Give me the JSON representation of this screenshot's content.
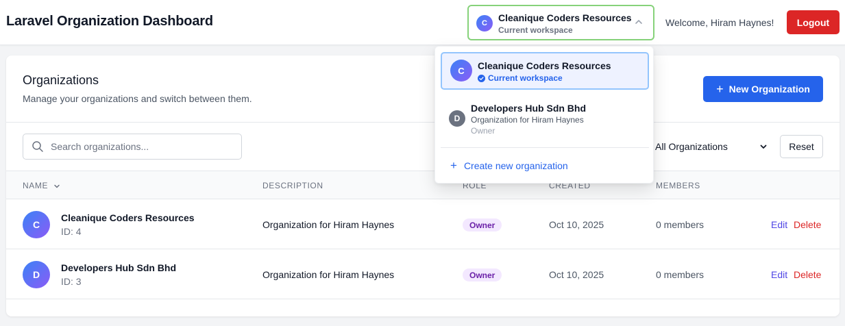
{
  "header": {
    "title": "Laravel Organization Dashboard",
    "workspace": {
      "avatar_letter": "C",
      "name": "Cleanique Coders Resources",
      "subtitle": "Current workspace"
    },
    "welcome": "Welcome, Hiram Haynes!",
    "logout_label": "Logout"
  },
  "dropdown": {
    "current": {
      "avatar_letter": "C",
      "name": "Cleanique Coders Resources",
      "label": "Current workspace"
    },
    "others": [
      {
        "avatar_letter": "D",
        "name": "Developers Hub Sdn Bhd",
        "description": "Organization for Hiram Haynes",
        "role": "Owner"
      }
    ],
    "create_label": "Create new organization"
  },
  "main": {
    "title": "Organizations",
    "description": "Manage your organizations and switch between them.",
    "new_button_label": "New Organization",
    "search_placeholder": "Search organizations...",
    "filter_value": "All Organizations",
    "reset_label": "Reset",
    "columns": [
      "Name",
      "Description",
      "Role",
      "Created",
      "Members"
    ],
    "rows": [
      {
        "avatar_letter": "C",
        "name": "Cleanique Coders Resources",
        "id": "ID: 4",
        "description": "Organization for Hiram Haynes",
        "role": "Owner",
        "created": "Oct 10, 2025",
        "members": "0 members",
        "edit_label": "Edit",
        "delete_label": "Delete"
      },
      {
        "avatar_letter": "D",
        "name": "Developers Hub Sdn Bhd",
        "id": "ID: 3",
        "description": "Organization for Hiram Haynes",
        "role": "Owner",
        "created": "Oct 10, 2025",
        "members": "0 members",
        "edit_label": "Edit",
        "delete_label": "Delete"
      }
    ]
  },
  "colors": {
    "primary": "#2563eb",
    "danger": "#dc2626",
    "switcher_border": "#86d27a",
    "role_badge_bg": "#f3e8ff",
    "role_badge_text": "#6b21a8",
    "edit_link": "#4f46e5"
  }
}
